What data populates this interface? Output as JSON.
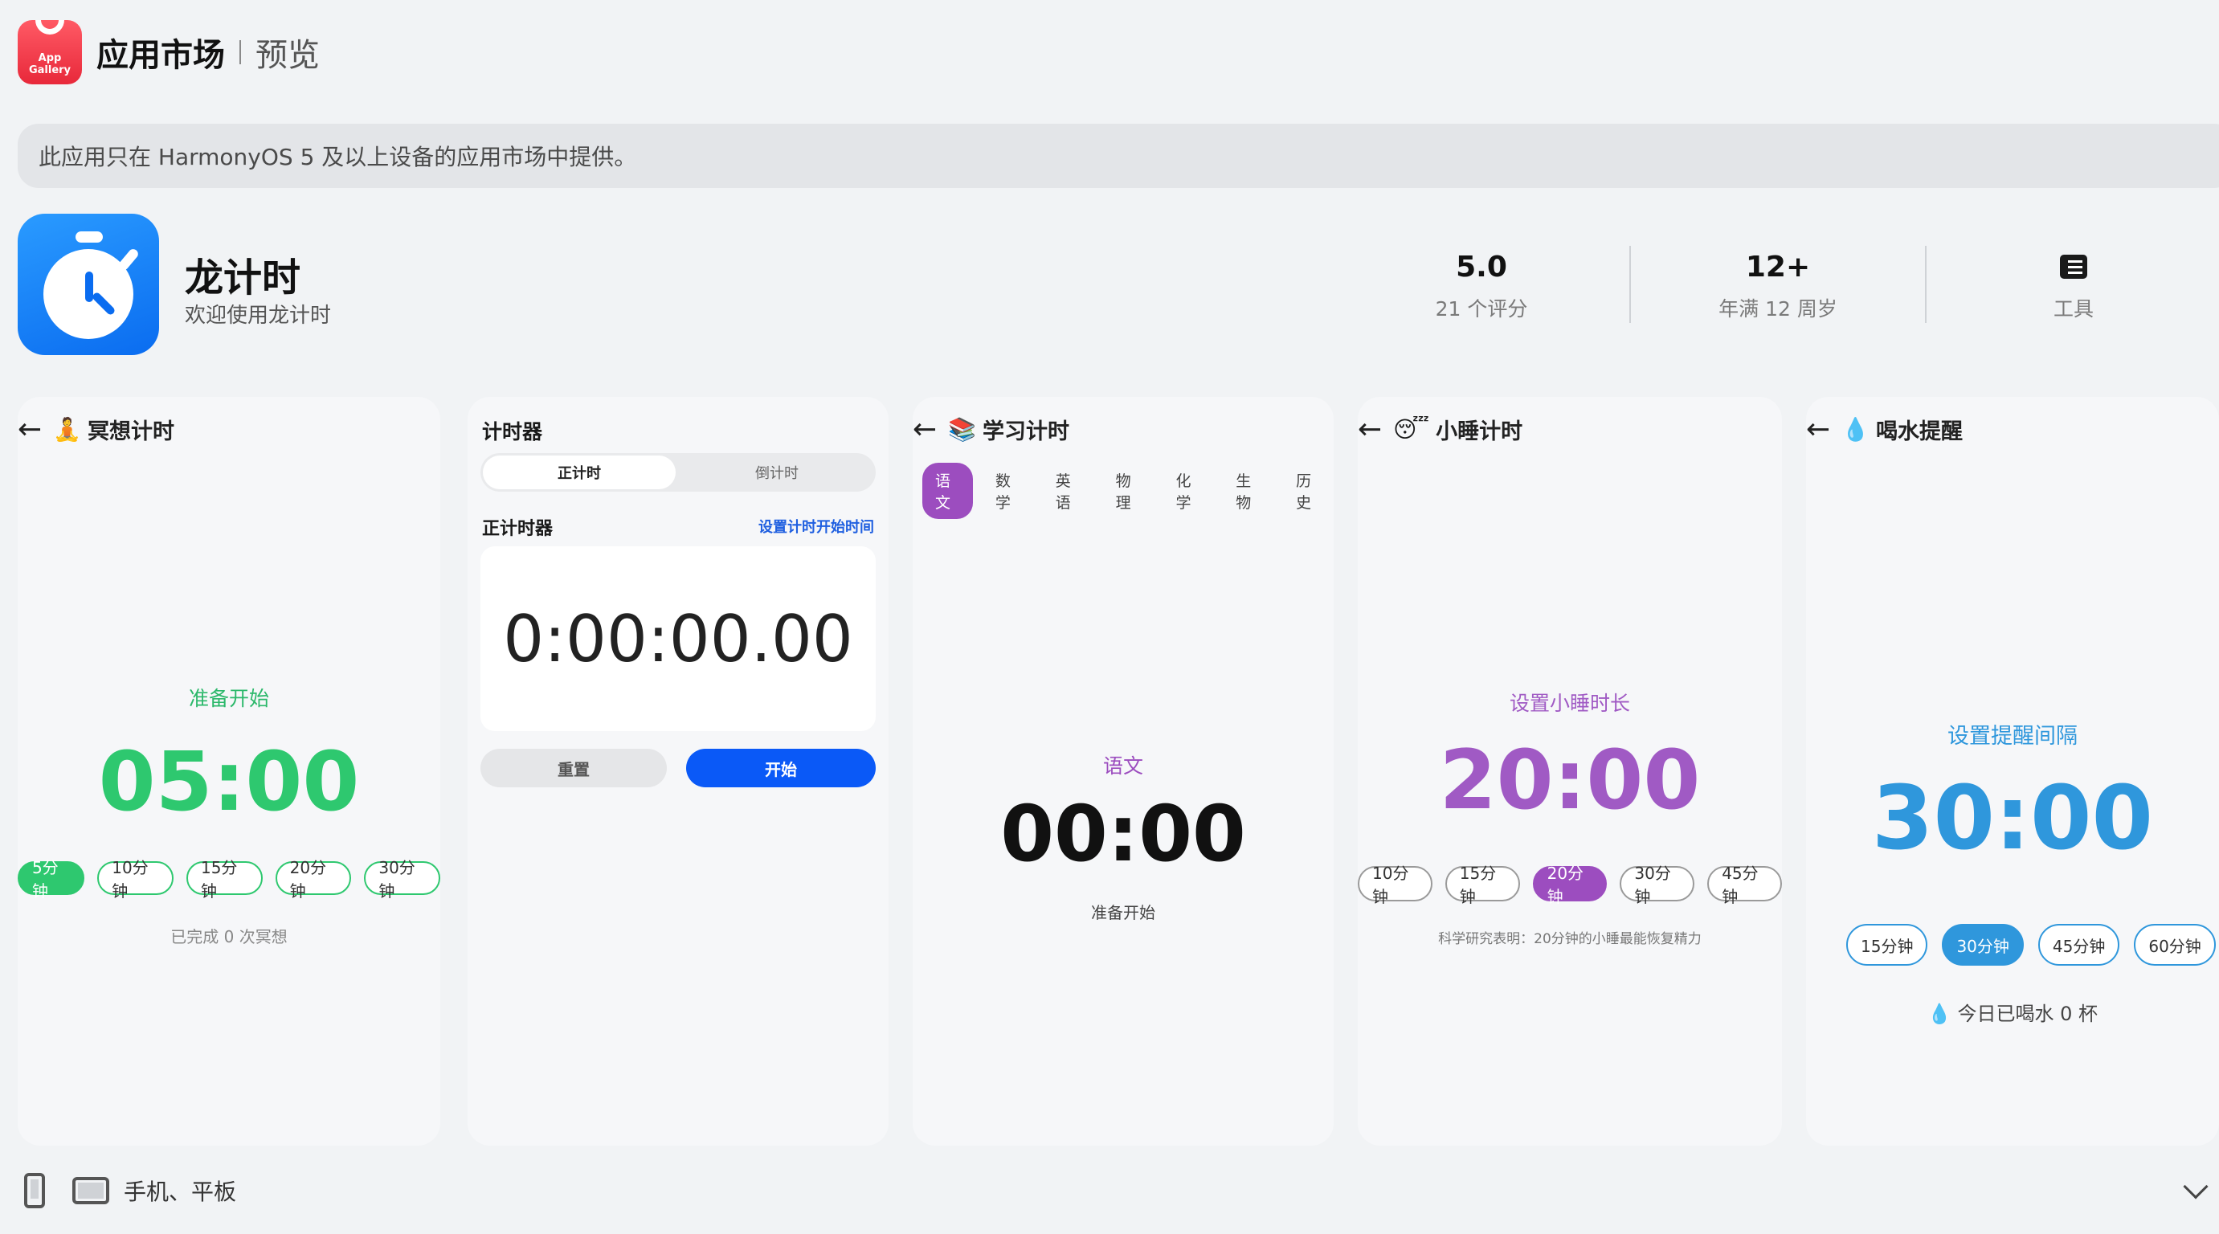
{
  "header": {
    "logo_text_line1": "App",
    "logo_text_line2": "Gallery",
    "title": "应用市场",
    "subtitle": "预览"
  },
  "notice": "此应用只在 HarmonyOS 5 及以上设备的应用市场中提供。",
  "app": {
    "name": "龙计时",
    "description": "欢迎使用龙计时",
    "rating_value": "5.0",
    "rating_label": "21 个评分",
    "age_value": "12+",
    "age_label": "年满 12 周岁",
    "category_label": "工具"
  },
  "screenshots": {
    "meditation": {
      "title": "冥想计时",
      "status": "准备开始",
      "time": "05:00",
      "chips": [
        "5分钟",
        "10分钟",
        "15分钟",
        "20分钟",
        "30分钟"
      ],
      "active_index": 0,
      "count_text": "已完成 0 次冥想",
      "accent": "#2ec86f"
    },
    "timer": {
      "title": "计时器",
      "tab_up": "正计时",
      "tab_down": "倒计时",
      "section_label": "正计时器",
      "set_start_link": "设置计时开始时间",
      "time": "0:00:00.00",
      "reset_label": "重置",
      "start_label": "开始",
      "accent": "#0a59f7"
    },
    "study": {
      "title": "学习计时",
      "subjects": [
        "语文",
        "数学",
        "英语",
        "物理",
        "化学",
        "生物",
        "历史"
      ],
      "active_index": 0,
      "current_subject": "语文",
      "time": "00:00",
      "status": "准备开始",
      "accent": "#9c4dbf"
    },
    "nap": {
      "title": "小睡计时",
      "label": "设置小睡时长",
      "time": "20:00",
      "chips": [
        "10分钟",
        "15分钟",
        "20分钟",
        "30分钟",
        "45分钟"
      ],
      "active_index": 2,
      "note": "科学研究表明：20分钟的小睡最能恢复精力",
      "accent": "#9c4dbf"
    },
    "water": {
      "title": "喝水提醒",
      "label": "设置提醒间隔",
      "time": "30:00",
      "chips": [
        "15分钟",
        "30分钟",
        "45分钟",
        "60分钟"
      ],
      "active_index": 1,
      "today_text": "今日已喝水 0 杯",
      "accent": "#2f97dc"
    }
  },
  "devices": {
    "text": "手机、平板",
    "icons": [
      "phone-icon",
      "tablet-icon"
    ]
  }
}
